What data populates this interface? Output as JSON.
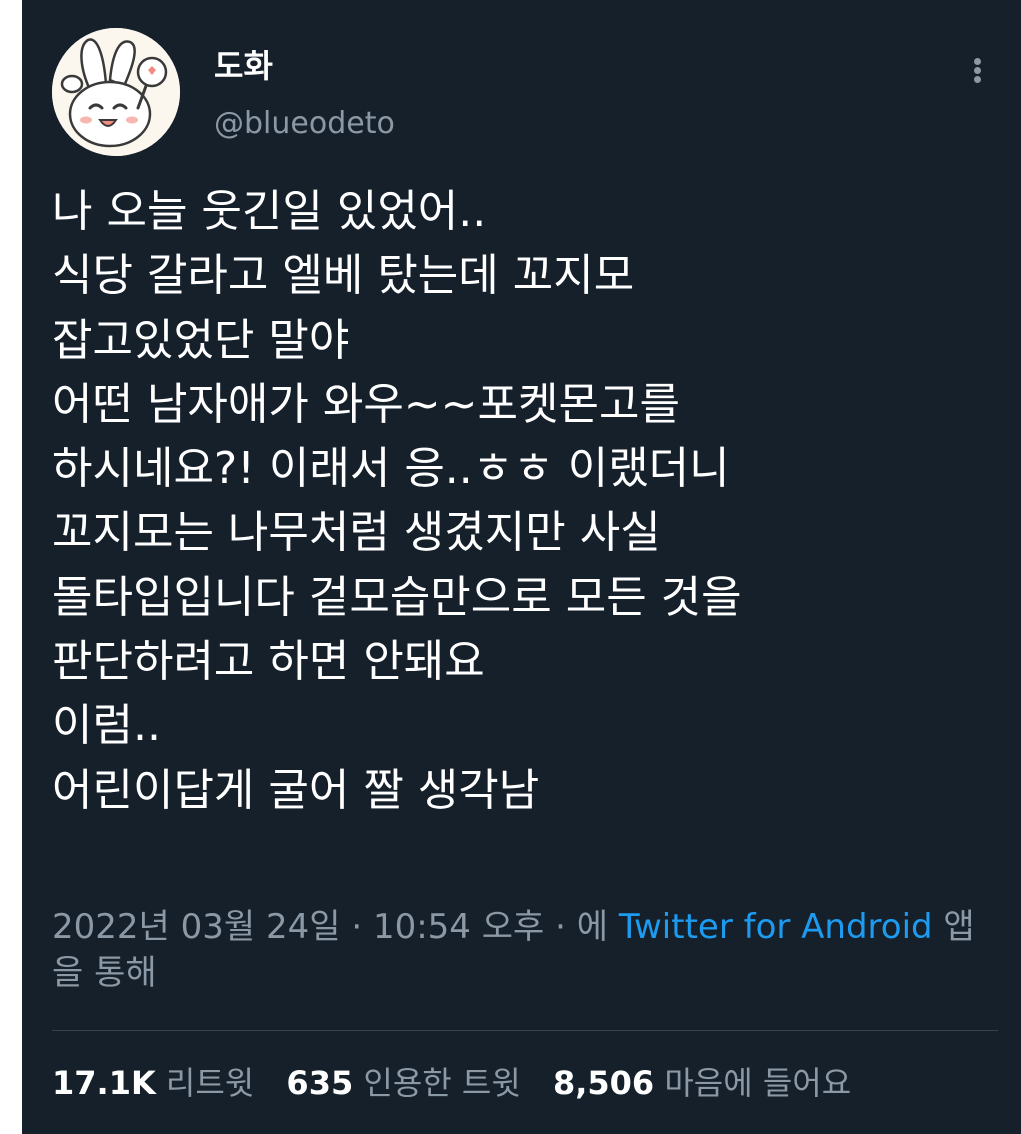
{
  "colors": {
    "background": "#15202b",
    "text_primary": "#ffffff",
    "text_secondary": "#8b98a5",
    "link": "#1d9bf0",
    "divider": "#38444d"
  },
  "author": {
    "avatar_icon": "rabbit-character-avatar",
    "display_name": "도화",
    "handle": "@blueodeto"
  },
  "menu": {
    "icon": "more-vertical-icon"
  },
  "tweet": {
    "lines": [
      "나 오늘 웃긴일 있었어..",
      "식당 갈라고 엘베 탔는데 꼬지모",
      "잡고있었단 말야",
      "어떤 남자애가 와우~~포켓몬고를",
      "하시네요?! 이래서 응..ㅎㅎ 이랬더니",
      "꼬지모는 나무처럼 생겼지만 사실",
      "돌타입입니다 겉모습만으로 모든 것을",
      "판단하려고 하면 안돼요",
      "이럼..",
      "어린이답게 굴어 짤 생각남"
    ]
  },
  "meta": {
    "date": "2022년 03월 24일",
    "separator": " · ",
    "time": "10:54 오후",
    "via_prefix": "에 ",
    "source": "Twitter for Android",
    "via_suffix": " 앱을 통해"
  },
  "stats": {
    "retweets_count": "17.1K",
    "retweets_label": "리트윗",
    "quotes_count": "635",
    "quotes_label": "인용한 트윗",
    "likes_count": "8,506",
    "likes_label": "마음에 들어요"
  }
}
